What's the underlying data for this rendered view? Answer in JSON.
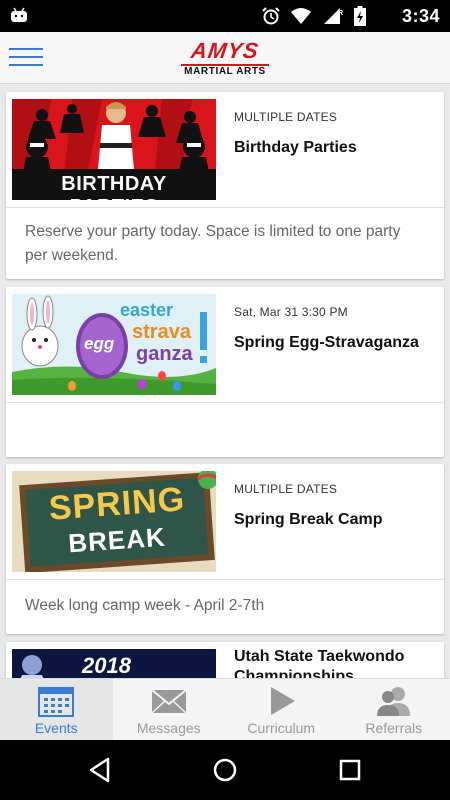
{
  "status_bar": {
    "time": "3:34",
    "icons": [
      "android-icon",
      "alarm-icon",
      "wifi-icon",
      "signal-icon",
      "battery-icon"
    ]
  },
  "app_bar": {
    "logo_text": "AMYS",
    "logo_subtext": "MARTIAL ARTS",
    "brand_color": "#d7141a",
    "accent_color": "#3a7bd5"
  },
  "events": [
    {
      "date": "MULTIPLE DATES",
      "title": "Birthday Parties",
      "description": "Reserve your party today. Space is limited to one party per weekend.",
      "image_text": "BIRTHDAY PARTIES"
    },
    {
      "date": "Sat, Mar 31 3:30 PM",
      "title": "Spring Egg-Stravaganza",
      "description": "",
      "image_text_1": "easter",
      "image_text_2": "egg",
      "image_text_3": "strava",
      "image_text_4": "ganza"
    },
    {
      "date": "MULTIPLE DATES",
      "title": "Spring Break Camp",
      "description": "Week long camp week - April 2-7th",
      "image_text_1": "SPRING",
      "image_text_2": "BREAK"
    },
    {
      "date": "",
      "title": "Utah State Taekwondo Championships",
      "description": "",
      "image_text": "2018"
    }
  ],
  "tabs": [
    {
      "label": "Events",
      "icon": "calendar-icon",
      "active": true
    },
    {
      "label": "Messages",
      "icon": "envelope-icon",
      "active": false
    },
    {
      "label": "Curriculum",
      "icon": "play-icon",
      "active": false
    },
    {
      "label": "Referrals",
      "icon": "people-icon",
      "active": false
    }
  ]
}
